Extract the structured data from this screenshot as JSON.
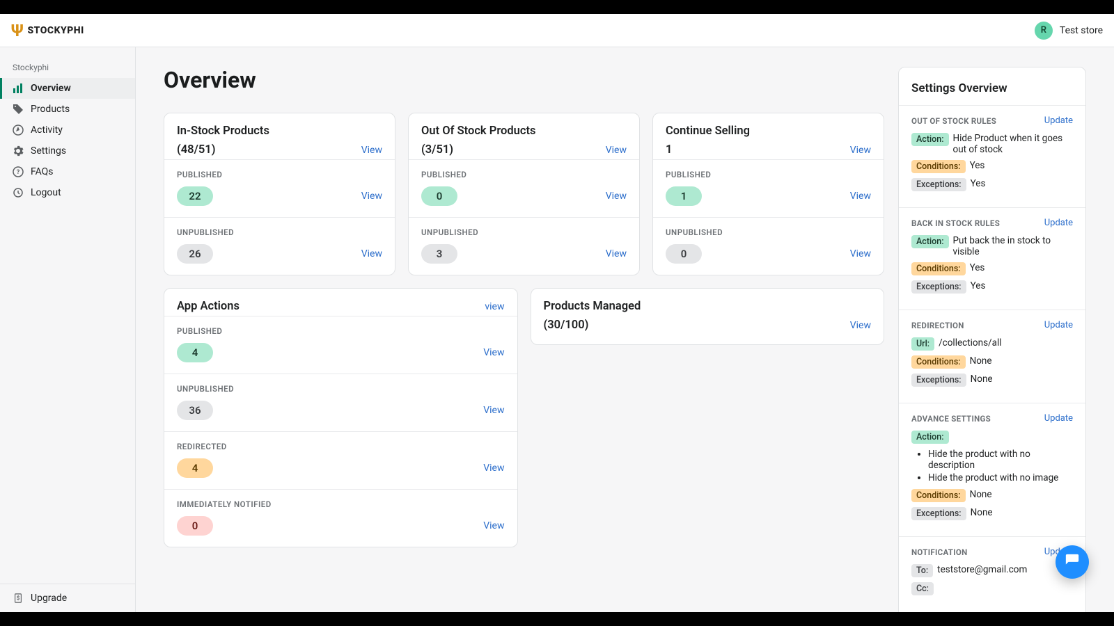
{
  "brand": {
    "name": "STOCKYPHI",
    "logo_glyph": "Ψ"
  },
  "store": {
    "initial": "R",
    "name": "Test store"
  },
  "sidebar": {
    "heading": "Stockyphi",
    "items": [
      {
        "label": "Overview"
      },
      {
        "label": "Products"
      },
      {
        "label": "Activity"
      },
      {
        "label": "Settings"
      },
      {
        "label": "FAQs"
      },
      {
        "label": "Logout"
      }
    ],
    "upgrade": "Upgrade"
  },
  "page": {
    "title": "Overview"
  },
  "labels": {
    "view": "View",
    "view_lower": "view",
    "published": "PUBLISHED",
    "unpublished": "UNPUBLISHED",
    "redirected": "REDIRECTED",
    "immediately_notified": "IMMEDIATELY NOTIFIED",
    "update": "Update"
  },
  "cards": {
    "in_stock": {
      "title": "In-Stock Products",
      "ratio": "(48/51)",
      "published": "22",
      "unpublished": "26"
    },
    "out_stock": {
      "title": "Out Of Stock Products",
      "ratio": "(3/51)",
      "published": "0",
      "unpublished": "3"
    },
    "continue_selling": {
      "title": "Continue Selling",
      "ratio": "1",
      "published": "1",
      "unpublished": "0"
    },
    "app_actions": {
      "title": "App Actions",
      "published": "4",
      "unpublished": "36",
      "redirected": "4",
      "immediately_notified": "0"
    },
    "products_managed": {
      "title": "Products Managed",
      "ratio": "(30/100)"
    }
  },
  "settings_panel": {
    "title": "Settings Overview",
    "out_of_stock": {
      "heading": "OUT OF STOCK RULES",
      "action_label": "Action:",
      "action_text": "Hide Product when it goes out of stock",
      "conditions_label": "Conditions:",
      "conditions_text": "Yes",
      "exceptions_label": "Exceptions:",
      "exceptions_text": "Yes"
    },
    "back_in_stock": {
      "heading": "BACK IN STOCK RULES",
      "action_label": "Action:",
      "action_text": "Put back the in stock to visible",
      "conditions_label": "Conditions:",
      "conditions_text": "Yes",
      "exceptions_label": "Exceptions:",
      "exceptions_text": "Yes"
    },
    "redirection": {
      "heading": "REDIRECTION",
      "url_label": "Url:",
      "url_text": "/collections/all",
      "conditions_label": "Conditions:",
      "conditions_text": "None",
      "exceptions_label": "Exceptions:",
      "exceptions_text": "None"
    },
    "advance": {
      "heading": "ADVANCE SETTINGS",
      "action_label": "Action:",
      "bullets": [
        "Hide the product with no description",
        "Hide the product with no image"
      ],
      "conditions_label": "Conditions:",
      "conditions_text": "None",
      "exceptions_label": "Exceptions:",
      "exceptions_text": "None"
    },
    "notification": {
      "heading": "NOTIFICATION",
      "to_label": "To:",
      "to_text": "teststore@gmail.com",
      "cc_label": "Cc:",
      "cc_text": ""
    }
  }
}
